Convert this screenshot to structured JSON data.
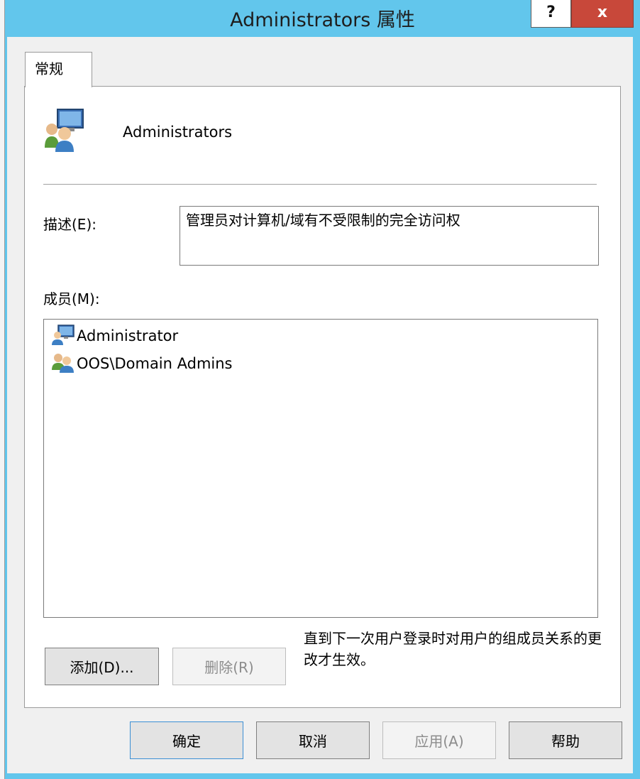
{
  "window": {
    "title": "Administrators 属性",
    "help_button": "?",
    "close_button": "x",
    "accent_color": "#62c6ec"
  },
  "tabs": [
    {
      "label": "常规",
      "selected": true
    }
  ],
  "group": {
    "icon": "group-users-icon",
    "name": "Administrators"
  },
  "description": {
    "label": "描述(E):",
    "value": "管理员对计算机/域有不受限制的完全访问权"
  },
  "members": {
    "label": "成员(M):",
    "items": [
      {
        "name": "Administrator",
        "icon": "user-computer-icon"
      },
      {
        "name": "OOS\\Domain Admins",
        "icon": "user-group-icon"
      }
    ]
  },
  "actions": {
    "add_label": "添加(D)...",
    "remove_label": "删除(R)",
    "note": "直到下一次用户登录时对用户的组成员关系的更改才生效。"
  },
  "footer": {
    "ok_label": "确定",
    "cancel_label": "取消",
    "apply_label": "应用(A)",
    "help_label": "帮助"
  }
}
